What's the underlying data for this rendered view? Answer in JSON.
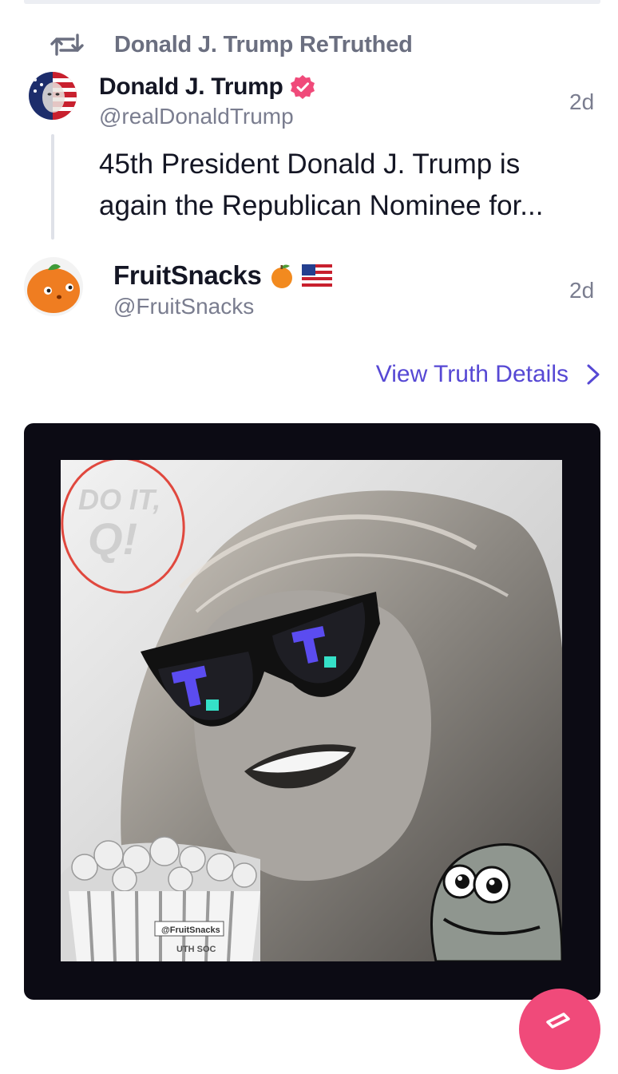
{
  "retruth": {
    "label": "Donald J. Trump ReTruthed",
    "icon": "retruth-icon"
  },
  "quoted_post": {
    "author_name": "Donald J. Trump",
    "handle": "@realDonaldTrump",
    "time": "2d",
    "text": "45th President Donald J. Trump is again the Republican Nominee for...",
    "verified": true
  },
  "post": {
    "author_name": "FruitSnacks",
    "handle": "@FruitSnacks",
    "time": "2d",
    "emojis": [
      "orange-emoji",
      "us-flag-emoji"
    ]
  },
  "view_details": {
    "label": "View Truth Details"
  },
  "media": {
    "overlay_text_line1": "DO IT,",
    "overlay_text_line2": "Q!",
    "popcorn_label": "@FruitSnacks",
    "popcorn_sub": "UTH SOC"
  },
  "colors": {
    "accent": "#5648d4",
    "verified": "#f04a7a",
    "fab": "#f04a7a"
  }
}
